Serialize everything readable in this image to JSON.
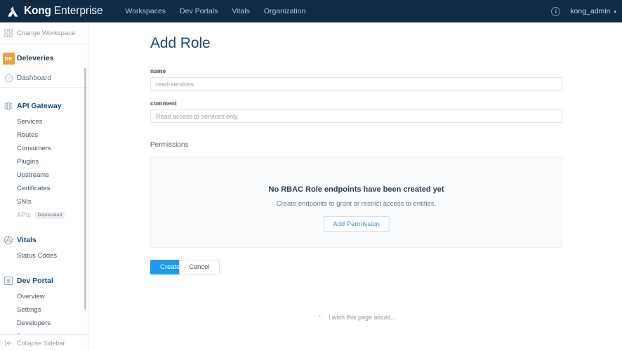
{
  "topnav": {
    "brand_primary": "Kong",
    "brand_secondary": "Enterprise",
    "logo_icon": "kong-logo-icon",
    "links": [
      {
        "label": "Workspaces"
      },
      {
        "label": "Dev Portals"
      },
      {
        "label": "Vitals"
      },
      {
        "label": "Organization"
      }
    ],
    "info_icon": "info-circle-icon",
    "info_glyph": "i",
    "user": "kong_admin",
    "user_caret": "▾",
    "background": "#122b45"
  },
  "sidebar": {
    "change_workspace": {
      "label": "Change Workspace",
      "icon": "grid-icon"
    },
    "workspace": {
      "badge": "DE",
      "label": "Deleveries",
      "badge_color": "#e8a33d"
    },
    "dashboard": {
      "label": "Dashboard",
      "icon": "gauge-icon"
    },
    "groups": [
      {
        "label": "API Gateway",
        "icon": "api-gateway-icon",
        "items": [
          {
            "label": "Services"
          },
          {
            "label": "Routes"
          },
          {
            "label": "Consumers"
          },
          {
            "label": "Plugins"
          },
          {
            "label": "Upstreams"
          },
          {
            "label": "Certificates"
          },
          {
            "label": "SNIs"
          },
          {
            "label": "APIs",
            "pill": "Deprecated",
            "muted": true
          }
        ]
      },
      {
        "label": "Vitals",
        "icon": "vitals-icon",
        "items": [
          {
            "label": "Status Codes"
          }
        ]
      },
      {
        "label": "Dev Portal",
        "icon": "dev-portal-icon",
        "items": [
          {
            "label": "Overview"
          },
          {
            "label": "Settings"
          },
          {
            "label": "Developers"
          },
          {
            "label": "Pages"
          }
        ]
      }
    ],
    "collapse": {
      "label": "Collapse Sidebar",
      "icon": "collapse-sidebar-icon"
    }
  },
  "main": {
    "title": "Add Role",
    "fields": [
      {
        "label": "name",
        "value": "",
        "placeholder": "read-services"
      },
      {
        "label": "comment",
        "value": "",
        "placeholder": "Read access to services only."
      }
    ],
    "permissions": {
      "section_label": "Permissions",
      "empty_title": "No RBAC Role endpoints have been created yet",
      "empty_subtitle": "Create endpoints to grant or restrict access to entities.",
      "add_button": "Add Permission"
    },
    "actions": {
      "create": "Create",
      "cancel": "Cancel",
      "create_color": "#1c9bf0"
    },
    "feedback": {
      "icon": "sparkle-icon",
      "text": "I wish this page would..."
    }
  }
}
